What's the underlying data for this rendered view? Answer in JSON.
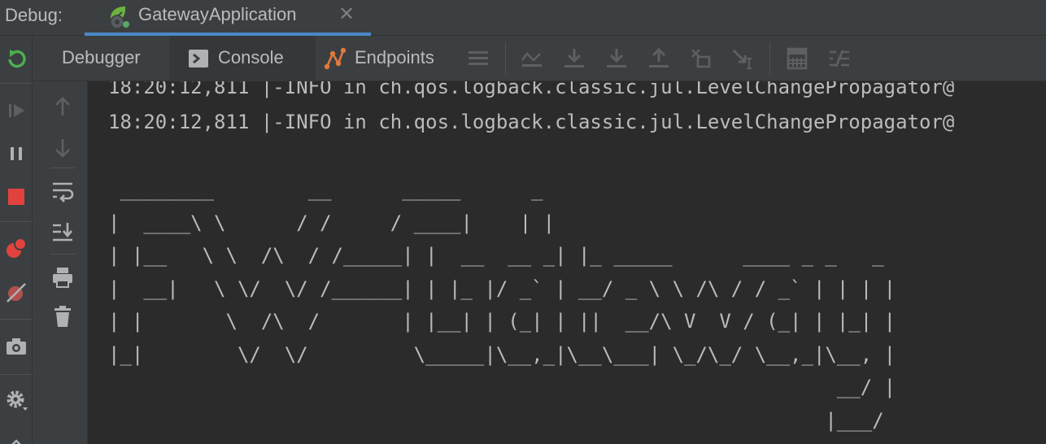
{
  "debug_bar": {
    "label": "Debug:",
    "tab_title": "GatewayApplication",
    "tab_icon": "spring-boot-icon",
    "close_glyph": "✕"
  },
  "toolbar": {
    "tabs": [
      {
        "label": "Debugger",
        "icon": ""
      },
      {
        "label": "Console",
        "icon": "console-icon"
      },
      {
        "label": "Endpoints",
        "icon": "endpoints-icon"
      }
    ],
    "actions": [
      "menu-icon",
      "show-execution-point-icon",
      "step-over-icon",
      "step-into-icon",
      "step-out-icon",
      "drop-frame-icon",
      "run-to-cursor-icon",
      "evaluate-icon",
      "trace-icon"
    ]
  },
  "left_actions": [
    "rerun-icon",
    "resume-icon",
    "pause-icon",
    "stop-icon",
    "view-breakpoints-icon",
    "mute-breakpoints-icon",
    "camera-icon",
    "settings-icon"
  ],
  "console_tools": [
    "up-icon",
    "down-icon",
    "soft-wrap-icon",
    "scroll-to-end-icon",
    "print-icon",
    "clear-icon"
  ],
  "console": {
    "log_lines": [
      "18:20:12,811 |-INFO in ch.qos.logback.classic.jul.LevelChangePropagator@",
      "18:20:12,811 |-INFO in ch.qos.logback.classic.jul.LevelChangePropagator@"
    ],
    "banner": [
      " ________        __      _____      _",
      "|  ____\\ \\      / /     / ____|    | |",
      "| |__   \\ \\  /\\  / /_____| |  __  __ _| |_ _____      ____ _ _   _",
      "|  __|   \\ \\/  \\/ /______| | |_ |/ _` | __/ _ \\ \\ /\\ / / _` | | | |",
      "| |       \\  /\\  /       | |__| | (_| | ||  __/\\ V  V / (_| | |_| |",
      "|_|        \\/  \\/         \\_____|\\__,_|\\__\\___| \\_/\\_/ \\__,_|\\__, |",
      "                                                              __/ |",
      "                                                             |___/"
    ]
  },
  "colors": {
    "background": "#2b2b2b",
    "panel": "#3c3f41",
    "accent": "#4a88c7",
    "rerun": "#4caf50",
    "stop": "#e2423d"
  }
}
